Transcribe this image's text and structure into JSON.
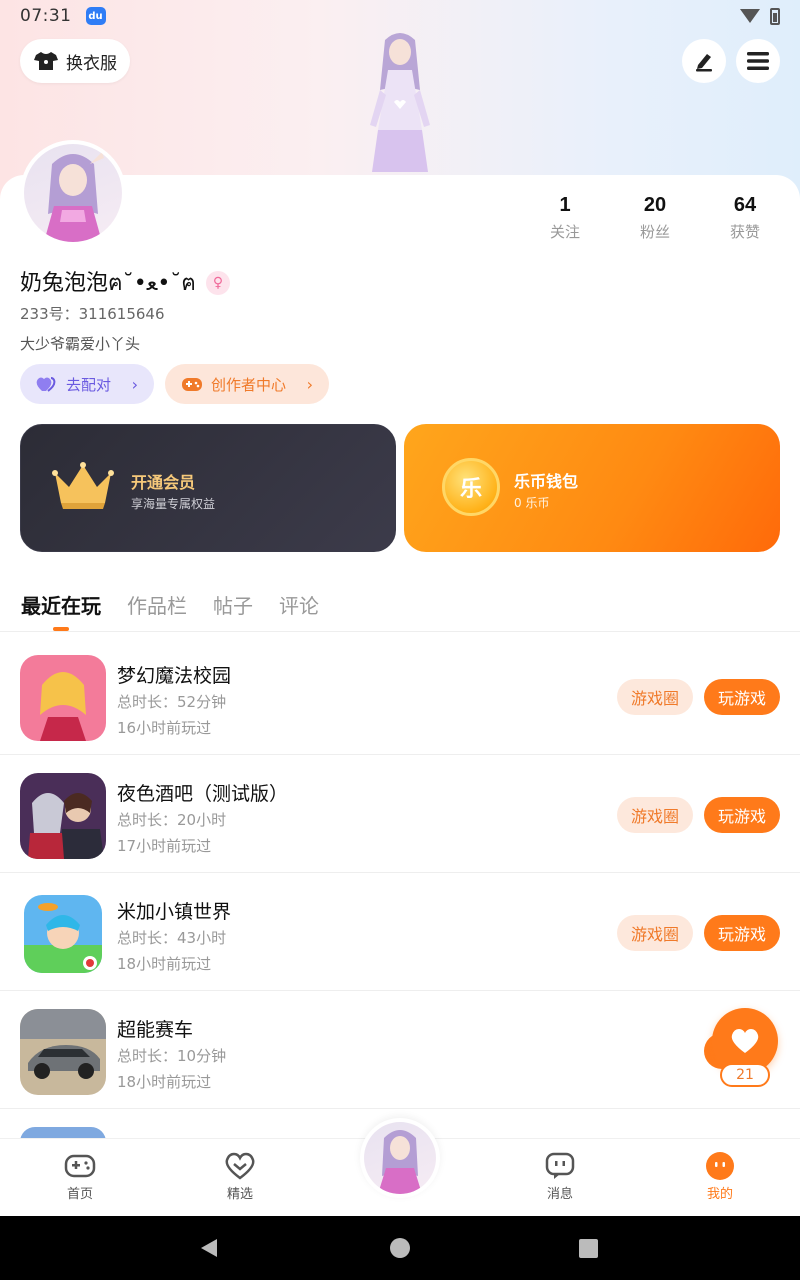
{
  "status": {
    "time": "07:31",
    "badge": "du"
  },
  "header": {
    "outfit_label": "换衣服"
  },
  "profile": {
    "nickname": "奶兔泡泡ฅ˘•ﻌ•˘ฅ",
    "gender_symbol": "♀",
    "uid": "233号：311615646",
    "bio": "大少爷霸爱小丫头",
    "stats": [
      {
        "num": "1",
        "label": "关注"
      },
      {
        "num": "20",
        "label": "粉丝"
      },
      {
        "num": "64",
        "label": "获赞"
      }
    ],
    "match_label": "去配对",
    "creator_label": "创作者中心"
  },
  "cards": {
    "vip": {
      "title": "开通会员",
      "subtitle": "享海量专属权益"
    },
    "wallet": {
      "title": "乐币钱包",
      "subtitle": "0 乐币",
      "coin_glyph": "乐"
    }
  },
  "tabs": [
    "最近在玩",
    "作品栏",
    "帖子",
    "评论"
  ],
  "games": [
    {
      "name": "梦幻魔法校园",
      "duration": "总时长：52分钟",
      "last_played": "16小时前玩过",
      "circle_label": "游戏圈",
      "play_label": "玩游戏"
    },
    {
      "name": "夜色酒吧（测试版）",
      "duration": "总时长：20小时",
      "last_played": "17小时前玩过",
      "circle_label": "游戏圈",
      "play_label": "玩游戏"
    },
    {
      "name": "米加小镇世界",
      "duration": "总时长：43小时",
      "last_played": "18小时前玩过",
      "circle_label": "游戏圈",
      "play_label": "玩游戏"
    },
    {
      "name": "超能赛车",
      "duration": "总时长：10分钟",
      "last_played": "18小时前玩过"
    }
  ],
  "fab": {
    "count": "21"
  },
  "nav": [
    {
      "label": "首页"
    },
    {
      "label": "精选"
    },
    {
      "label": "消息"
    },
    {
      "label": "我的"
    }
  ],
  "colors": {
    "accent": "#ff7a1a",
    "purple": "#6a5ae0"
  }
}
